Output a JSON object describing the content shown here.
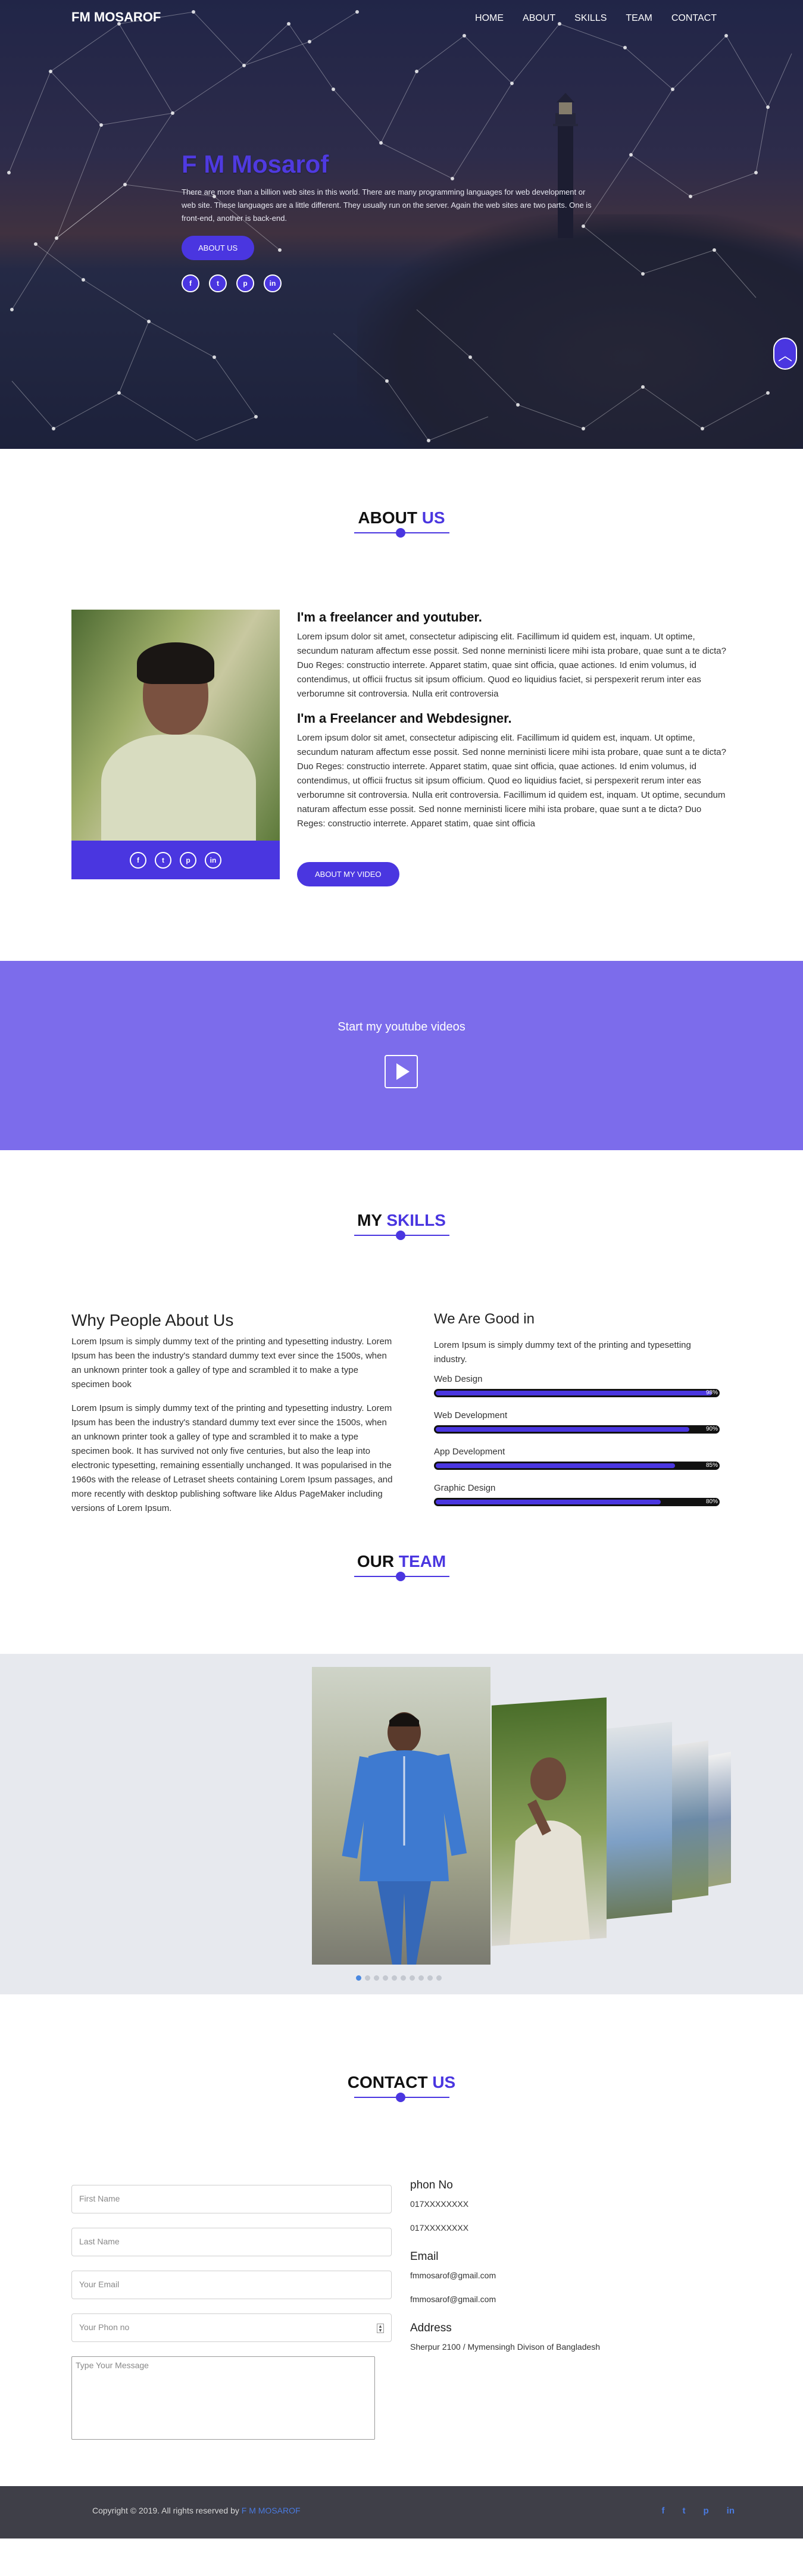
{
  "nav": {
    "brand": "FM MOSAROF",
    "items": [
      "HOME",
      "ABOUT",
      "SKILLS",
      "TEAM",
      "CONTACT"
    ]
  },
  "hero": {
    "title": "F M Mosarof",
    "text": "There are more than a billion web sites in this world. There are many programming languages for web development or web site. These languages are a little different. They usually run on the server. Again the web sites are two parts. One is front-end, another is back-end.",
    "button": "ABOUT US",
    "socials": [
      "f",
      "t",
      "p",
      "in"
    ]
  },
  "about": {
    "title_main": "ABOUT",
    "title_accent": "US",
    "heading1": "I'm a freelancer and youtuber.",
    "para1": "Lorem ipsum dolor sit amet, consectetur adipiscing elit. Facillimum id quidem est, inquam. Ut optime, secundum naturam affectum esse possit. Sed nonne merninisti licere mihi ista probare, quae sunt a te dicta? Duo Reges: constructio interrete. Apparet statim, quae sint officia, quae actiones. Id enim volumus, id contendimus, ut officii fructus sit ipsum officium. Quod eo liquidius faciet, si perspexerit rerum inter eas verborumne sit controversia. Nulla erit controversia",
    "heading2": "I'm a Freelancer and Webdesigner.",
    "para2": "Lorem ipsum dolor sit amet, consectetur adipiscing elit. Facillimum id quidem est, inquam. Ut optime, secundum naturam affectum esse possit. Sed nonne merninisti licere mihi ista probare, quae sunt a te dicta? Duo Reges: constructio interrete. Apparet statim, quae sint officia, quae actiones. Id enim volumus, id contendimus, ut officii fructus sit ipsum officium. Quod eo liquidius faciet, si perspexerit rerum inter eas verborumne sit controversia. Nulla erit controversia. Facillimum id quidem est, inquam. Ut optime, secundum naturam affectum esse possit. Sed nonne merninisti licere mihi ista probare, quae sunt a te dicta? Duo Reges: constructio interrete. Apparet statim, quae sint officia",
    "button": "ABOUT MY VIDEO",
    "socials": [
      "f",
      "t",
      "p",
      "in"
    ]
  },
  "video": {
    "title": "Start my youtube videos"
  },
  "skills": {
    "title_main": "MY",
    "title_accent": "SKILLS",
    "why_heading": "Why People About Us",
    "why_para1": "Lorem Ipsum is simply dummy text of the printing and typesetting industry. Lorem Ipsum has been the industry's standard dummy text ever since the 1500s, when an unknown printer took a galley of type and scrambled it to make a type specimen book",
    "why_para2": "Lorem Ipsum is simply dummy text of the printing and typesetting industry. Lorem Ipsum has been the industry's standard dummy text ever since the 1500s, when an unknown printer took a galley of type and scrambled it to make a type specimen book. It has survived not only five centuries, but also the leap into electronic typesetting, remaining essentially unchanged. It was popularised in the 1960s with the release of Letraset sheets containing Lorem Ipsum passages, and more recently with desktop publishing software like Aldus PageMaker including versions of Lorem Ipsum.",
    "good_heading": "We Are Good in",
    "good_intro": "Lorem Ipsum is simply dummy text of the printing and typesetting industry.",
    "items": [
      {
        "name": "Web Design",
        "percent": 98,
        "label": "98%"
      },
      {
        "name": "Web Development",
        "percent": 90,
        "label": "90%"
      },
      {
        "name": "App Development",
        "percent": 85,
        "label": "85%"
      },
      {
        "name": "Graphic Design",
        "percent": 80,
        "label": "80%"
      }
    ]
  },
  "team": {
    "title_main": "OUR",
    "title_accent": "TEAM",
    "dot_count": 10,
    "active_dot": 0
  },
  "contact": {
    "title_main": "CONTACT",
    "title_accent": "US",
    "first_name_placeholder": "First Name",
    "last_name_placeholder": "Last Name",
    "email_placeholder": "Your Email",
    "phone_placeholder": "Your Phon no",
    "message_placeholder": "Type Your Message",
    "phone_heading": "phon No",
    "phone1": "017XXXXXXXX",
    "phone2": "017XXXXXXXX",
    "email_heading": "Email",
    "email1": "fmmosarof@gmail.com",
    "email2": "fmmosarof@gmail.com",
    "address_heading": "Address",
    "address": "Sherpur 2100 / Mymensingh Divison of Bangladesh"
  },
  "footer": {
    "copy_prefix": "Copyright © 2019. All rights reserved by",
    "owner": "F M MOSAROF",
    "socials": [
      "f",
      "t",
      "p",
      "in"
    ]
  },
  "colors": {
    "accent": "#4a36e0",
    "video_band": "#7c6ceb",
    "footer_bg": "#3f3f48"
  }
}
